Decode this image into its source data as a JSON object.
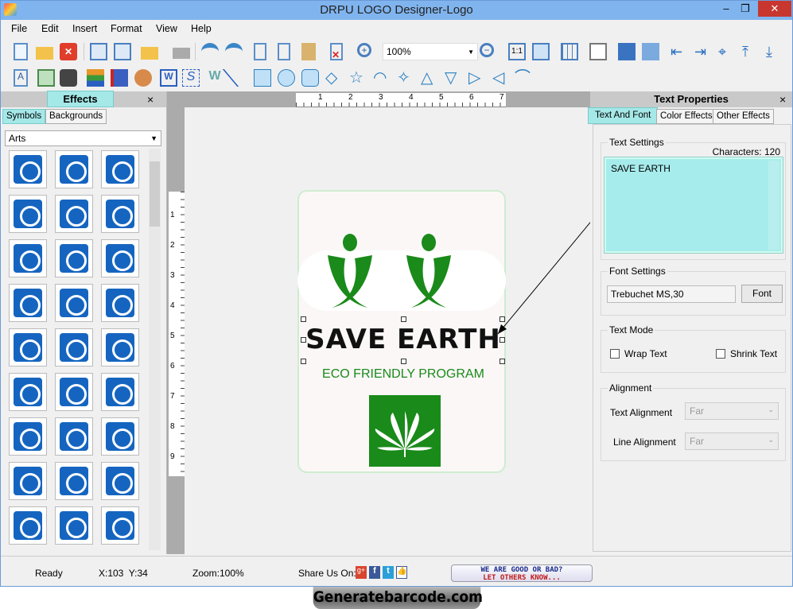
{
  "window": {
    "title": "DRPU LOGO Designer-Logo",
    "controls": [
      "–",
      "❐",
      "✕"
    ]
  },
  "menu": [
    "File",
    "Edit",
    "Insert",
    "Format",
    "View",
    "Help"
  ],
  "toolbar": {
    "zoom_value": "100%",
    "zoom_one_to_one": "1:1"
  },
  "left_panel": {
    "title": "Effects",
    "close": "×",
    "tabs": [
      "Symbols",
      "Backgrounds"
    ],
    "category": "Arts",
    "symbol_rows": 9,
    "symbol_cols": 3
  },
  "canvas": {
    "ruler_top": [
      "1",
      "2",
      "3",
      "4",
      "5",
      "6",
      "7"
    ],
    "ruler_left": [
      "1",
      "2",
      "3",
      "4",
      "5",
      "6",
      "7",
      "8",
      "9"
    ],
    "logo": {
      "headline": "SAVE EARTH",
      "tagline": "ECO FRIENDLY PROGRAM",
      "green": "#1a8a1a"
    }
  },
  "right_panel": {
    "title": "Text Properties",
    "close": "×",
    "tabs": [
      "Text And Font",
      "Color Effects",
      "Other Effects"
    ],
    "text_settings": {
      "label": "Text Settings",
      "characters": "Characters: 120",
      "text": "SAVE EARTH"
    },
    "font_settings": {
      "label": "Font Settings",
      "value": "Trebuchet MS,30",
      "button": "Font"
    },
    "text_mode": {
      "label": "Text Mode",
      "wrap": "Wrap Text",
      "shrink": "Shrink Text",
      "wrap_checked": false,
      "shrink_checked": false
    },
    "alignment": {
      "label": "Alignment",
      "text_alignment_label": "Text Alignment",
      "text_alignment": "Far",
      "line_alignment_label": "Line Alignment",
      "line_alignment": "Far"
    }
  },
  "status": {
    "state": "Ready",
    "coords": "X:103  Y:34",
    "zoom": "Zoom:100%",
    "share": "Share Us On:",
    "feedback_line1": "WE ARE GOOD OR BAD?",
    "feedback_line2": "LET OTHERS KNOW..."
  },
  "watermark": "Generatebarcode.com"
}
